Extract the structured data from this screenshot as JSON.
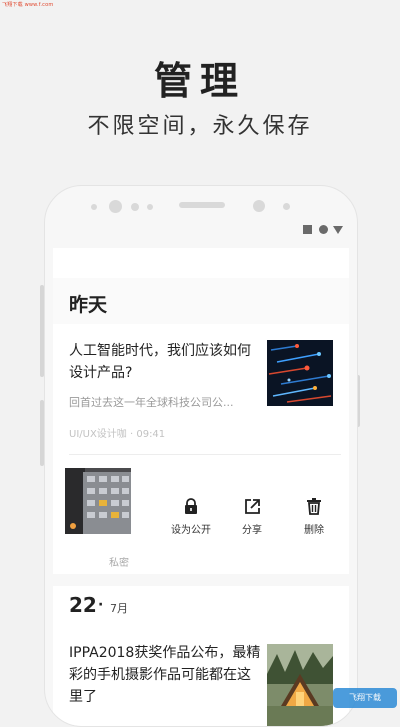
{
  "watermark": "飞翔下载 www.f.com",
  "promo": {
    "headline": "管理",
    "subline": "不限空间，永久保存"
  },
  "screen": {
    "section_yesterday": "昨天",
    "article1": {
      "title": "人工智能时代，我们应该如何设计产品?",
      "excerpt": "回首过去这一年全球科技公司公...",
      "meta": "UI/UX设计咖 · 09:41",
      "thumb_icon": "ai-network-thumbnail"
    },
    "swipe_actions": {
      "set_public": "设为公开",
      "share": "分享",
      "delete": "删除",
      "private_label": "私密",
      "lock_icon": "lock-icon",
      "share_icon": "share-icon",
      "trash_icon": "trash-icon"
    },
    "date_section": {
      "day": "22",
      "dot": "·",
      "month": "7月"
    },
    "article2": {
      "title": "IPPA2018获奖作品公布，最精彩的手机摄影作品可能都在这里了",
      "thumb_icon": "cabin-photo-thumbnail"
    }
  },
  "brand_badge": "飞翔下载",
  "colors": {
    "background": "#f2f2f2",
    "card": "#ffffff",
    "text": "#222222",
    "muted": "#9a9a9a",
    "watermark": "#e0452b"
  }
}
